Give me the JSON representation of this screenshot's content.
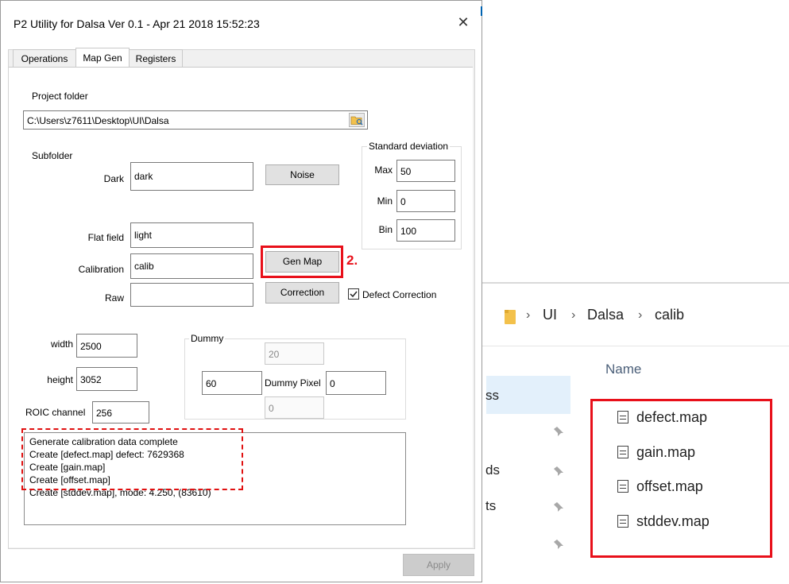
{
  "window": {
    "title": "P2 Utility for Dalsa Ver 0.1 - Apr 21 2018 15:52:23",
    "close_glyph": "✕"
  },
  "tabs": [
    {
      "label": "Operations",
      "active": false
    },
    {
      "label": "Map Gen",
      "active": true
    },
    {
      "label": "Registers",
      "active": false
    }
  ],
  "project": {
    "label": "Project folder",
    "path": "C:\\Users\\z7611\\Desktop\\UI\\Dalsa",
    "browse_icon": "folder-browse-icon"
  },
  "subfolder": {
    "label": "Subfolder",
    "dark_label": "Dark",
    "dark_value": "dark",
    "flat_label": "Flat field",
    "flat_value": "light",
    "calib_label": "Calibration",
    "calib_value": "calib",
    "raw_label": "Raw",
    "raw_value": ""
  },
  "buttons": {
    "noise": "Noise",
    "gen_map": "Gen Map",
    "correction": "Correction",
    "apply": "Apply"
  },
  "annotation": {
    "step": "2."
  },
  "defect_correction": {
    "label": "Defect Correction",
    "checked": true
  },
  "std_dev": {
    "title": "Standard deviation",
    "max_label": "Max",
    "max_value": "50",
    "min_label": "Min",
    "min_value": "0",
    "bin_label": "Bin",
    "bin_value": "100"
  },
  "dims": {
    "width_label": "width",
    "width_value": "2500",
    "height_label": "height",
    "height_value": "3052",
    "roic_label": "ROIC channel",
    "roic_value": "256"
  },
  "dummy": {
    "title": "Dummy",
    "top_value": "20",
    "left_value": "60",
    "pixel_label": "Dummy Pixel",
    "pixel_value": "0",
    "bottom_value": "0"
  },
  "log": [
    "Generate calibration data complete",
    "Create [defect.map] defect: 7629368",
    "Create [gain.map]",
    "Create [offset.map]",
    "Create [stddev.map], mode: 4.250, (83610)"
  ],
  "explorer": {
    "breadcrumb": [
      "UI",
      "Dalsa",
      "calib"
    ],
    "name_header": "Name",
    "nav_fragments": [
      "ss",
      "ds",
      "ts"
    ],
    "files": [
      "defect.map",
      "gain.map",
      "offset.map",
      "stddev.map"
    ]
  },
  "colors": {
    "highlight": "#e8101a",
    "nav_selection": "#cce4f7",
    "folder": "#f3c14b"
  }
}
